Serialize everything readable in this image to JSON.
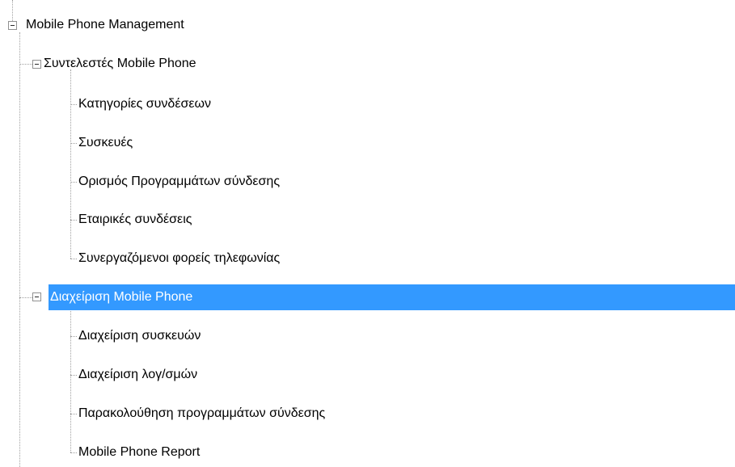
{
  "tree": {
    "root": {
      "label": "Mobile Phone Management",
      "expanded": true,
      "children": [
        {
          "label": "Συντελεστές Mobile Phone",
          "expanded": true,
          "items": [
            "Κατηγορίες συνδέσεων",
            "Συσκευές",
            "Ορισμός Προγραμμάτων σύνδεσης",
            "Εταιρικές συνδέσεις",
            "Συνεργαζόμενοι φορείς τηλεφωνίας"
          ]
        },
        {
          "label": "Διαχείριση Mobile Phone",
          "expanded": true,
          "selected": true,
          "items": [
            "Διαχείριση συσκευών",
            "Διαχείριση λογ/σμών",
            "Παρακολούθηση προγραμμάτων σύνδεσης",
            "Mobile Phone Report"
          ]
        }
      ]
    }
  },
  "colors": {
    "selection_background": "#3399ff",
    "selection_text": "#ffffff",
    "tree_lines": "#a0a0a0"
  },
  "icons": {
    "expander": "minus-box-icon"
  }
}
